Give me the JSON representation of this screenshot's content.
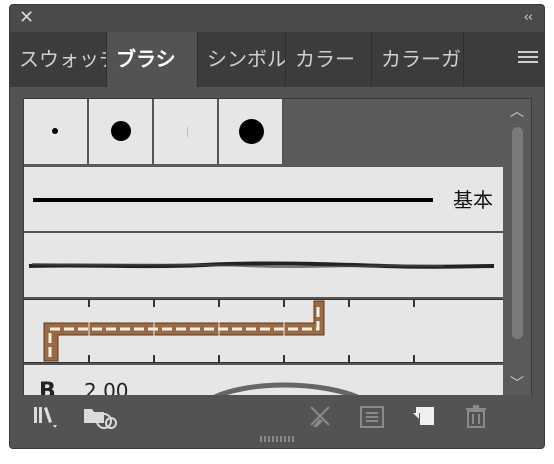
{
  "tabs": [
    {
      "label": "スウォッチ"
    },
    {
      "label": "ブラシ"
    },
    {
      "label": "シンボル"
    },
    {
      "label": "カラー"
    },
    {
      "label": "カラーガイド"
    }
  ],
  "brush_rows": {
    "basic_label": "基本"
  },
  "bottom_text": "2.00",
  "icons": {
    "close": "close-icon",
    "collapse": "double-chevron-icon",
    "menu": "hamburger-menu-icon",
    "library": "brush-library-icon",
    "cc_library": "creative-cloud-libraries-icon",
    "remove_stroke": "remove-brush-stroke-icon",
    "options": "brush-options-icon",
    "new": "new-brush-icon",
    "delete": "trash-icon"
  }
}
